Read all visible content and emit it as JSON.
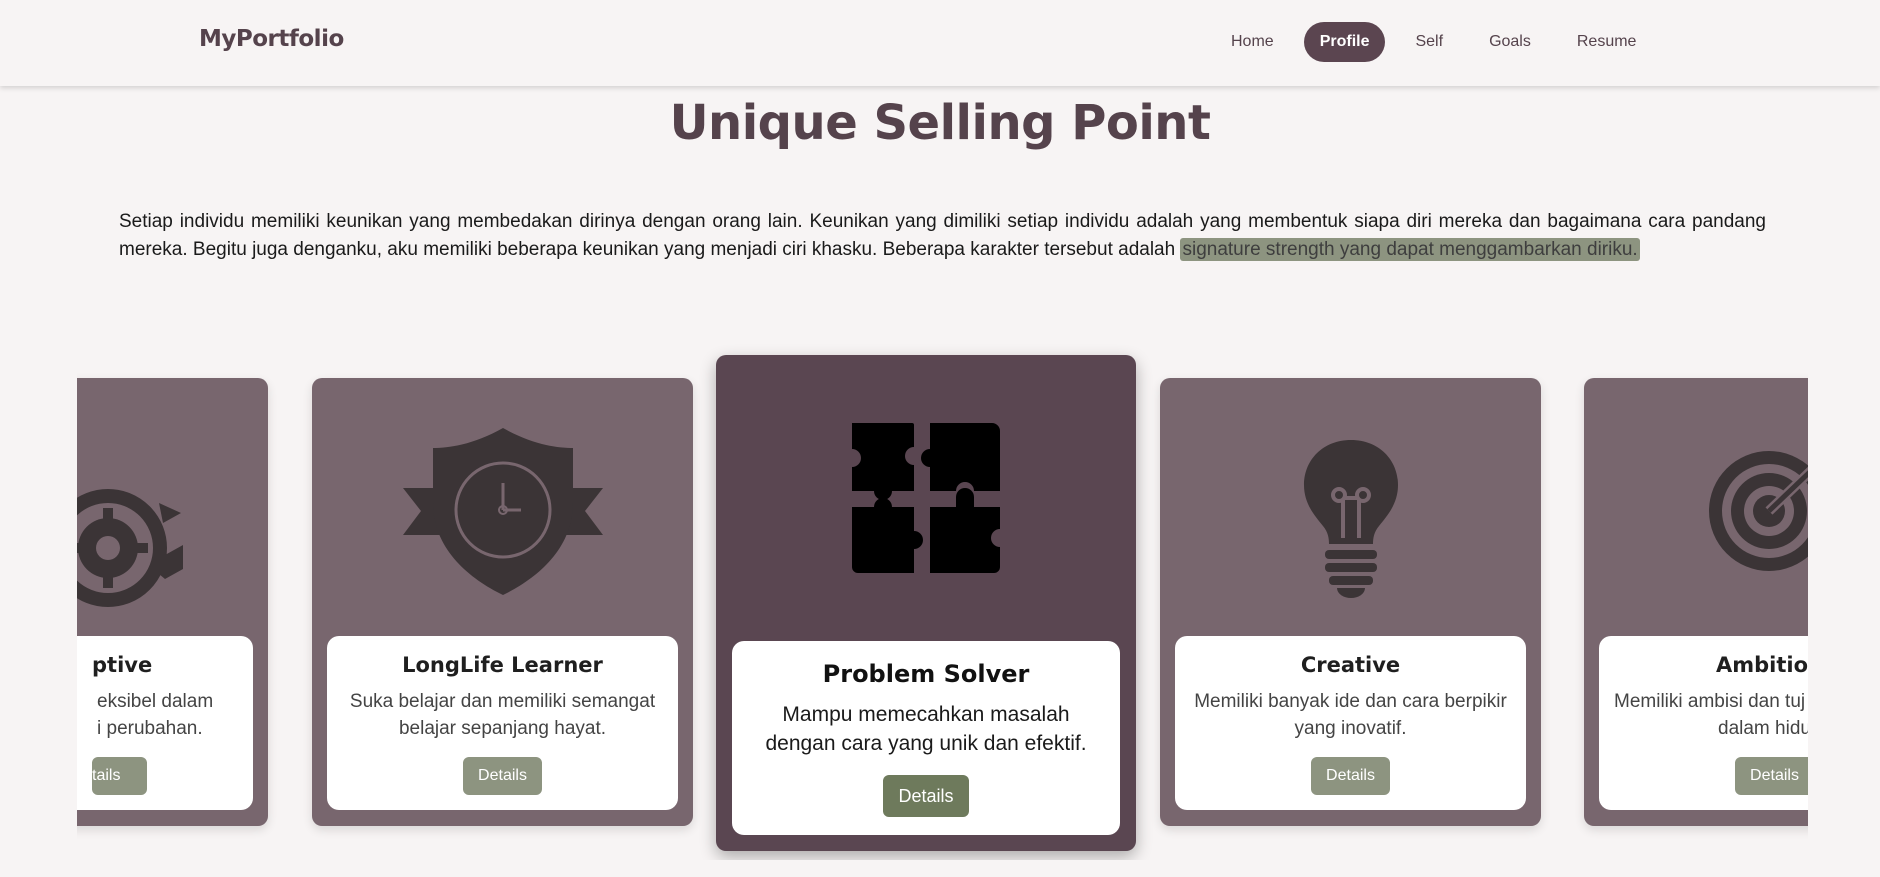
{
  "navbar": {
    "brand": "MyPortfolio",
    "items": [
      {
        "label": "Home",
        "active": false
      },
      {
        "label": "Profile",
        "active": true
      },
      {
        "label": "Self",
        "active": false
      },
      {
        "label": "Goals",
        "active": false
      },
      {
        "label": "Resume",
        "active": false
      }
    ]
  },
  "section": {
    "title": "Unique Selling Point",
    "intro": "Setiap individu memiliki keunikan yang membedakan dirinya dengan orang lain. Keunikan yang dimiliki setiap individu adalah yang membentuk siapa diri mereka dan bagaimana cara pandang mereka. Begitu juga denganku, aku memiliki beberapa keunikan yang menjadi ciri khasku. Beberapa karakter tersebut adalah ",
    "intro_highlight": "signature strength yang dapat menggambarkan diriku."
  },
  "cards": [
    {
      "title": "Adaptive",
      "visible_title": "ptive",
      "desc_line1": "eksibel dalam",
      "desc_line2": "i perubahan.",
      "button": "Details",
      "visible_button": "tails",
      "icon": "gear-cycle-icon"
    },
    {
      "title": "LongLife Learner",
      "desc_line1": "Suka belajar dan memiliki semangat",
      "desc_line2": "belajar sepanjang hayat.",
      "button": "Details",
      "icon": "shield-clock-icon"
    },
    {
      "title": "Problem Solver",
      "desc_line1": "Mampu memecahkan masalah",
      "desc_line2": "dengan cara yang unik dan efektif.",
      "button": "Details",
      "icon": "puzzle-icon"
    },
    {
      "title": "Creative",
      "desc_line1": "Memiliki banyak ide dan cara berpikir",
      "desc_line2": "yang inovatif.",
      "button": "Details",
      "icon": "lightbulb-icon"
    },
    {
      "title": "Ambitious",
      "visible_title": "Ambitiou",
      "desc_line1": "Memiliki ambisi dan tuj",
      "desc_line2": "dalam hidu",
      "button": "Details",
      "icon": "target-icon"
    }
  ],
  "colors": {
    "brand": "#55434c",
    "card": "#78666e",
    "card_active": "#5a4651",
    "button": "#8d9480",
    "button_active": "#6e7a5c"
  }
}
